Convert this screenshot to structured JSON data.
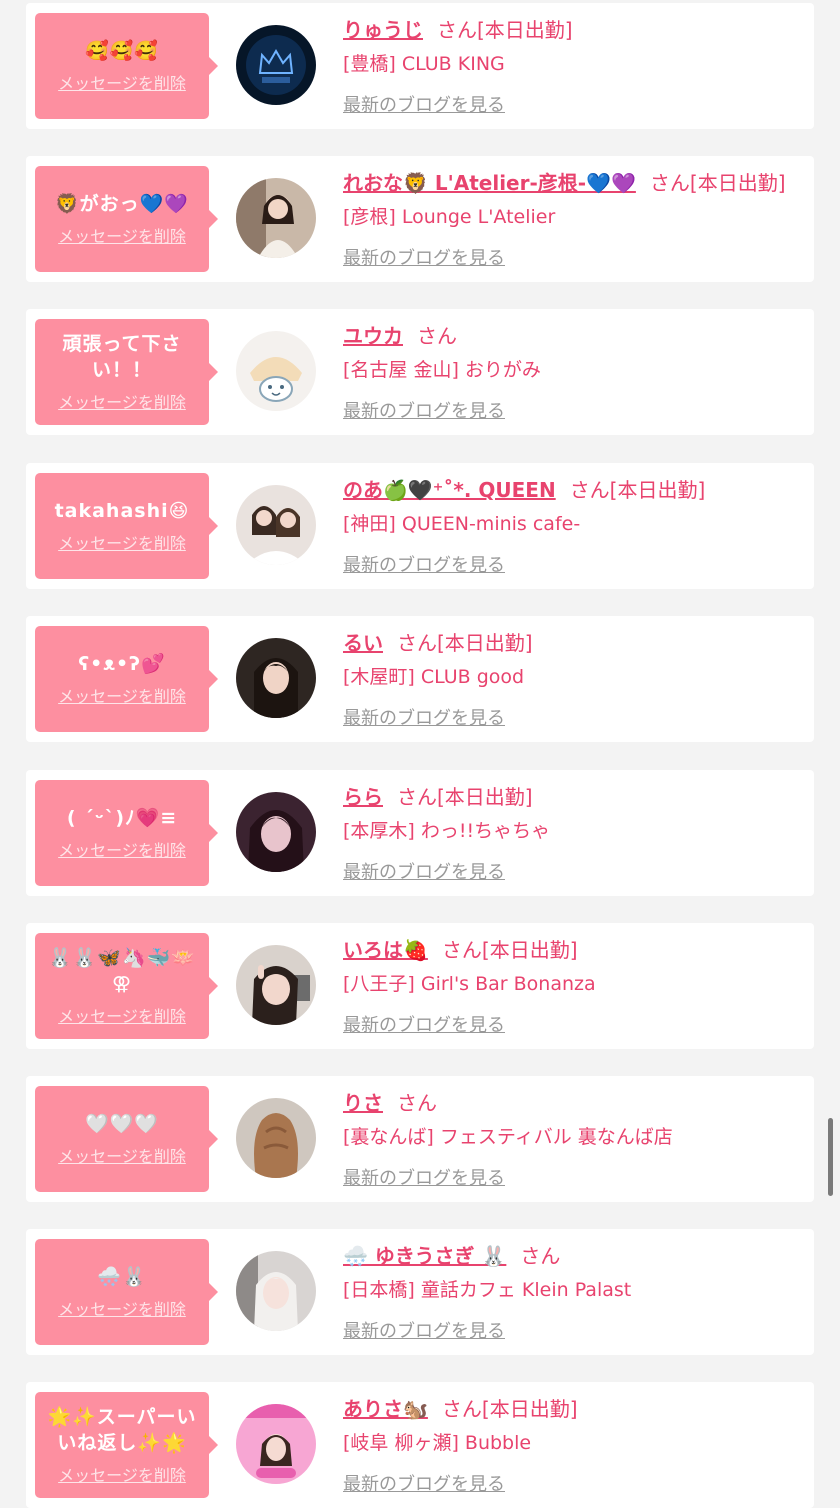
{
  "colors": {
    "accent": "#e8436e",
    "bubble": "#fd8fa0",
    "link_gray": "#999999",
    "background": "#f3f3f3"
  },
  "items": [
    {
      "message": "🥰🥰🥰",
      "delete_label": "メッセージを削除",
      "name": "りゅうじ",
      "suffix": "さん[本日出勤]",
      "shop": "[豊橋] CLUB KING",
      "blog": "最新のブログを見る",
      "avatar": "crown-logo-avatar"
    },
    {
      "message": "🦁がおっ💙💜",
      "delete_label": "メッセージを削除",
      "name": "れおな🦁 L'Atelier-彦根-💙💜",
      "suffix": "さん[本日出勤]",
      "shop": "[彦根] Lounge L'Atelier",
      "blog": "最新のブログを見る",
      "avatar": "woman-portrait-avatar"
    },
    {
      "message": "頑張って下さい！！",
      "delete_label": "メッセージを削除",
      "name": "ユウカ",
      "suffix": "さん",
      "shop": "[名古屋 金山] おりがみ",
      "blog": "最新のブログを見る",
      "avatar": "cartoon-face-avatar"
    },
    {
      "message": "takahashi😆",
      "delete_label": "メッセージを削除",
      "name": "のあ🍏🖤⁺˚*. QUEEN",
      "suffix": "さん[本日出勤]",
      "shop": "[神田] QUEEN-minis cafe-",
      "blog": "最新のブログを見る",
      "avatar": "woman-portrait-avatar"
    },
    {
      "message": "ʕ•ᴥ•ʔ💕",
      "delete_label": "メッセージを削除",
      "name": "るい",
      "suffix": "さん[本日出勤]",
      "shop": "[木屋町] CLUB good",
      "blog": "最新のブログを見る",
      "avatar": "woman-portrait-avatar"
    },
    {
      "message": "( ˊᵕˋ)ﾉ💗≡",
      "delete_label": "メッセージを削除",
      "name": "らら",
      "suffix": "さん[本日出勤]",
      "shop": "[本厚木] わっ!!ちゃちゃ",
      "blog": "最新のブログを見る",
      "avatar": "woman-portrait-avatar"
    },
    {
      "message": "🐰🐰🦋🦄🐳🪷⚢",
      "delete_label": "メッセージを削除",
      "name": "いろは🍓",
      "suffix": "さん[本日出勤]",
      "shop": "[八王子] Girl's Bar Bonanza",
      "blog": "最新のブログを見る",
      "avatar": "woman-portrait-avatar"
    },
    {
      "message": "🤍🤍🤍",
      "delete_label": "メッセージを削除",
      "name": "りさ",
      "suffix": "さん",
      "shop": "[裏なんば] フェスティバル 裏なんば店",
      "blog": "最新のブログを見る",
      "avatar": "woman-back-avatar"
    },
    {
      "message": "🌨️🐰",
      "delete_label": "メッセージを削除",
      "name": "🌨️ ゆきうさぎ 🐰",
      "suffix": "さん",
      "shop": "[日本橋] 童話カフェ Klein Palast",
      "blog": "最新のブログを見る",
      "avatar": "woman-portrait-avatar"
    },
    {
      "message": "🌟✨スーパーいいね返し✨🌟",
      "delete_label": "メッセージを削除",
      "name": "ありさ🐿️",
      "suffix": "さん[本日出勤]",
      "shop": "[岐阜 柳ヶ瀬] Bubble",
      "blog": "最新のブログを見る",
      "avatar": "bubble-logo-avatar"
    }
  ]
}
